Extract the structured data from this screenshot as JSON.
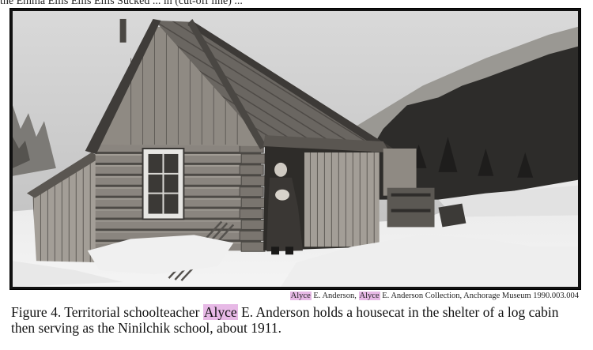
{
  "document": {
    "top_text": "the Emma Ellis Ellis Ellis Sucked ... in (cut-off line) ...",
    "photo": {
      "subject": "log-cabin-schoolhouse-photo"
    },
    "credit": {
      "name_highlight_1": "Alyce",
      "text_1": " E. Anderson, ",
      "name_highlight_2": "Alyce",
      "text_2": " E. Anderson Collection, Anchorage Museum 1990.003.004"
    },
    "caption": {
      "prefix": "Figure 4.  Territorial schoolteacher ",
      "highlight": "Alyce",
      "suffix": " E. Anderson holds a housecat in the shelter of a log cabin then serving as the Ninilchik school, about 1911."
    },
    "colors": {
      "highlight": "#e7b9e6"
    }
  }
}
